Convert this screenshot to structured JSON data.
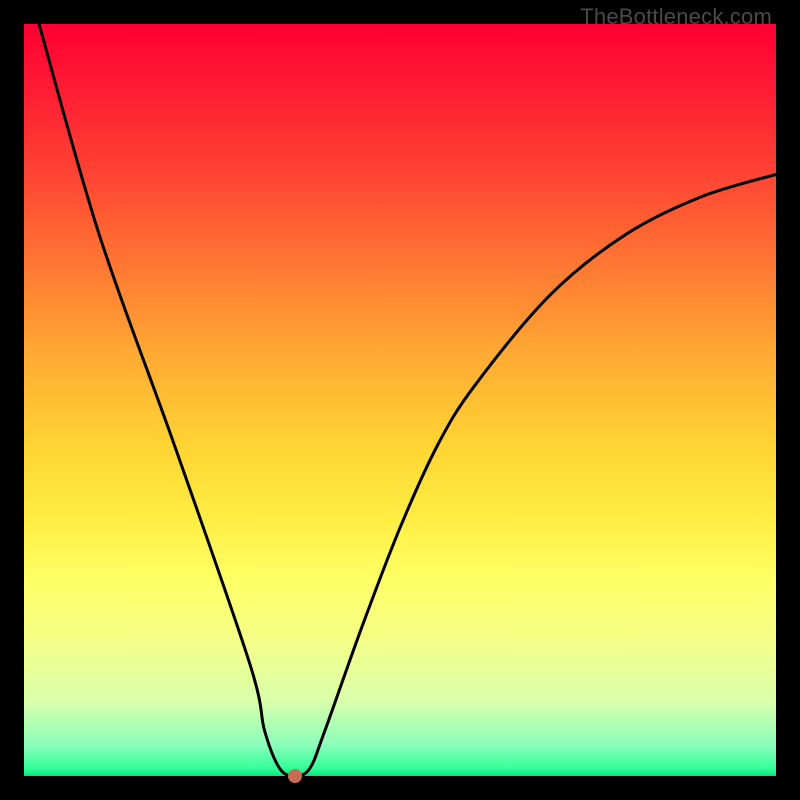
{
  "watermark": "TheBottleneck.com",
  "chart_data": {
    "type": "line",
    "title": "",
    "xlabel": "",
    "ylabel": "",
    "xlim": [
      0,
      100
    ],
    "ylim": [
      0,
      100
    ],
    "series": [
      {
        "name": "curve",
        "x": [
          2,
          10,
          20,
          30,
          32,
          34,
          36,
          38,
          40,
          45,
          50,
          55,
          60,
          70,
          80,
          90,
          100
        ],
        "y": [
          100,
          72,
          44,
          15,
          6,
          1,
          0,
          1,
          6,
          20,
          33,
          44,
          52,
          64,
          72,
          77,
          80
        ]
      }
    ],
    "marker": {
      "x": 36,
      "y": 0,
      "color": "#c96a54"
    },
    "colors": {
      "gradient_top": "#ff0033",
      "gradient_bottom": "#00e676",
      "curve": "#000000",
      "frame": "#000000"
    }
  }
}
